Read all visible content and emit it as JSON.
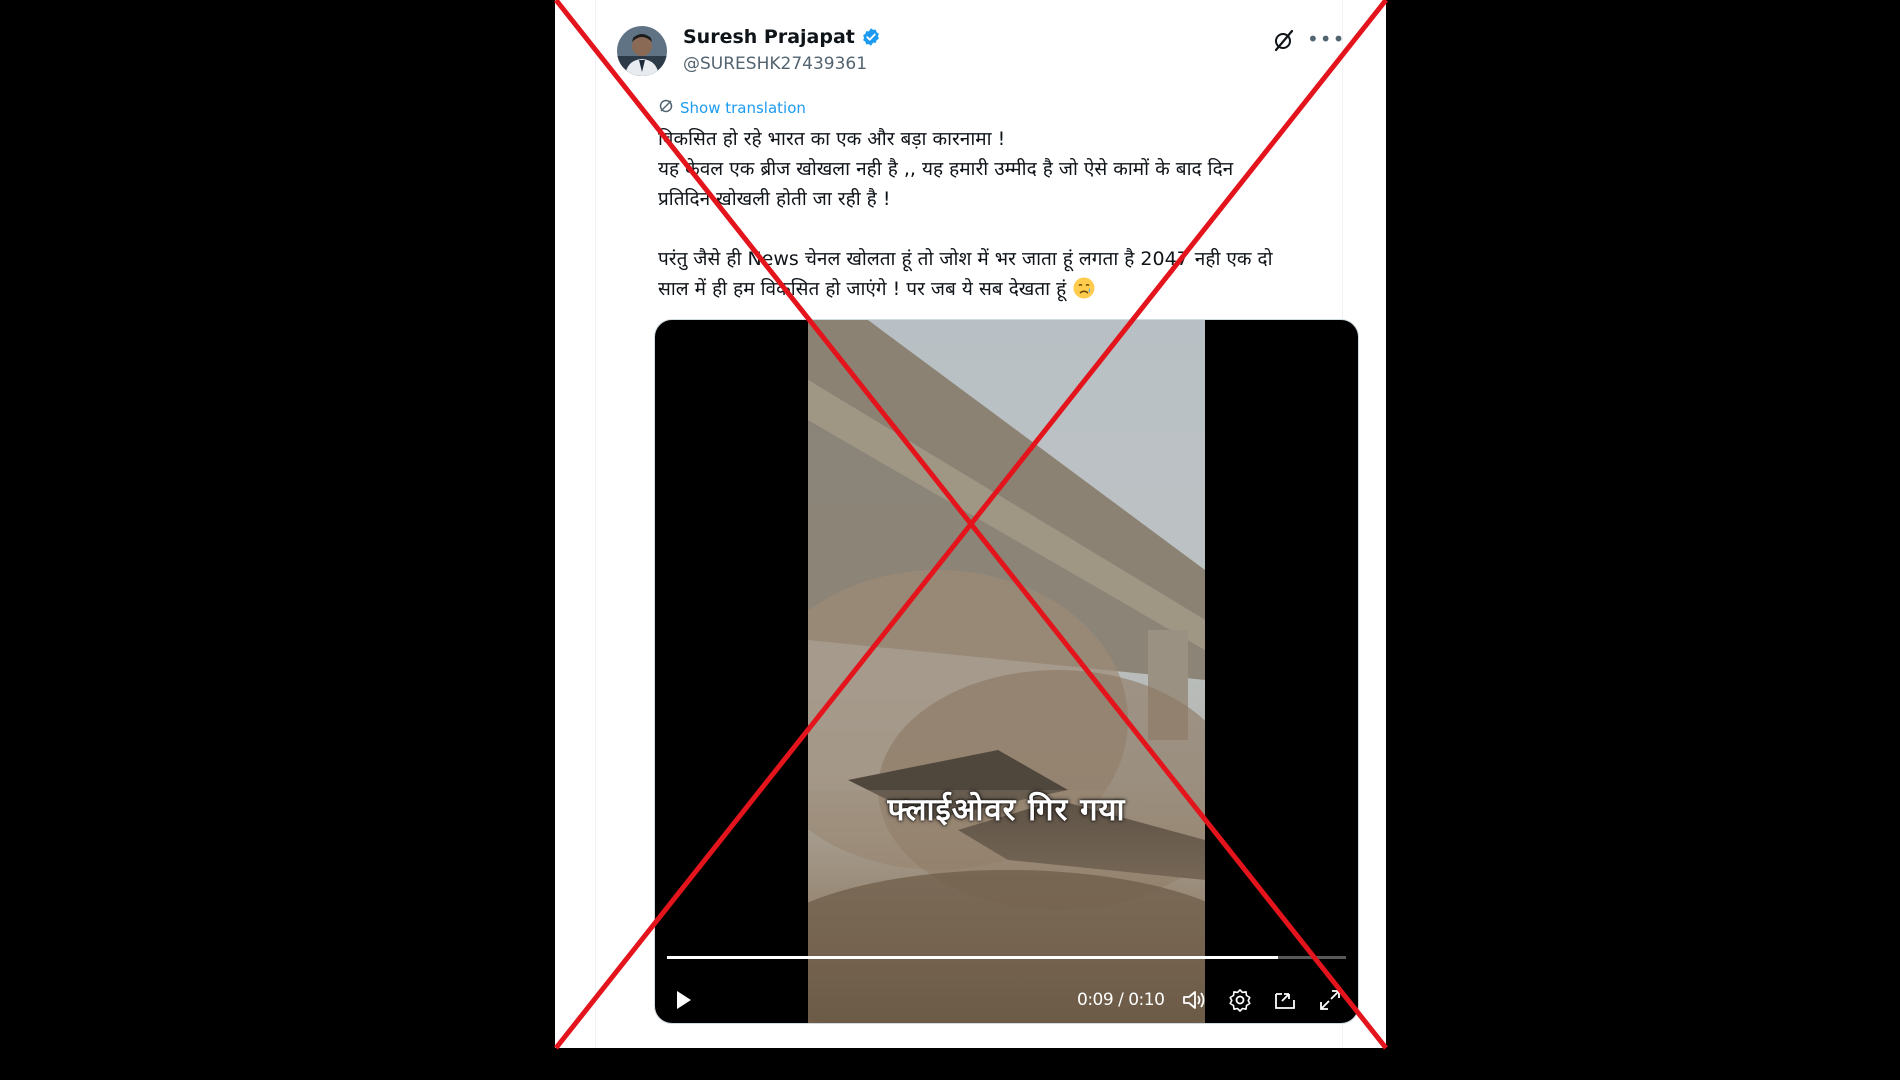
{
  "tweet": {
    "author": {
      "name": "Suresh Prajapat",
      "handle": "@SURESHK27439361",
      "verified": true,
      "verified_color": "#1d9bf0"
    },
    "show_translation_label": "Show translation",
    "text_lines": [
      "विकसित हो रहे भारत का एक और बड़ा कारनामा !",
      "यह केवल एक ब्रीज खोखला नही है ,, यह हमारी उम्मीद है जो ऐसे कामों के बाद दिन",
      "प्रतिदिन खोखली होती जा रही है !",
      "परंतु जैसे ही News चेनल खोलता हूं तो जोश में भर जाता हूं लगता है 2047 नही एक दो",
      "साल में ही हम विकसित हो जाएंगे ! पर जब ये सब देखता हूं"
    ],
    "trailing_emoji": "crying-face-emoji",
    "icons": {
      "grok": "grok-icon",
      "more": "more-options-icon",
      "translate": "translate-icon"
    }
  },
  "video": {
    "caption": "फ्लाईओवर गिर गया",
    "current_time": "0:09",
    "duration": "0:10",
    "time_display": "0:09 / 0:10",
    "progress": 0.9,
    "controls": [
      "play-icon",
      "volume-icon",
      "settings-icon",
      "picture-in-picture-icon",
      "fullscreen-icon"
    ]
  },
  "overlay": {
    "mark": "red-x-cross",
    "color": "#e3141b"
  },
  "colors": {
    "text_primary": "#0f1419",
    "text_secondary": "#536471",
    "link": "#1d9bf0",
    "background": "#000000"
  }
}
